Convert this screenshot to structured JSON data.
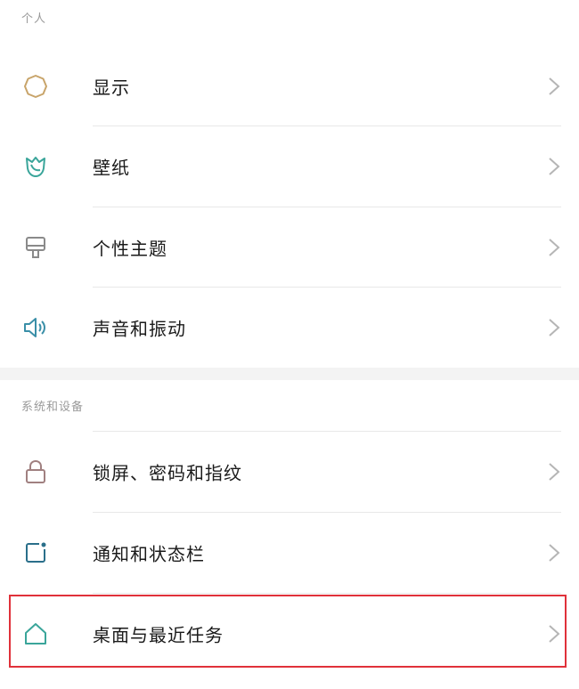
{
  "sections": [
    {
      "header": "个人",
      "items": [
        {
          "label": "显示",
          "icon": "brightness-icon"
        },
        {
          "label": "壁纸",
          "icon": "wallpaper-flower-icon"
        },
        {
          "label": "个性主题",
          "icon": "theme-brush-icon"
        },
        {
          "label": "声音和振动",
          "icon": "speaker-icon"
        }
      ]
    },
    {
      "header": "系统和设备",
      "items": [
        {
          "label": "锁屏、密码和指纹",
          "icon": "lock-icon"
        },
        {
          "label": "通知和状态栏",
          "icon": "notification-icon"
        },
        {
          "label": "桌面与最近任务",
          "icon": "home-icon"
        }
      ]
    }
  ],
  "colors": {
    "brightness_icon": "#c8a46a",
    "wallpaper_icon": "#3aa59a",
    "theme_icon": "#8a8a8a",
    "speaker_icon": "#3a8fa8",
    "lock_icon": "#a08080",
    "notification_icon": "#2a6f8a",
    "home_icon": "#3aa59a",
    "highlight_border": "#e0313a"
  }
}
